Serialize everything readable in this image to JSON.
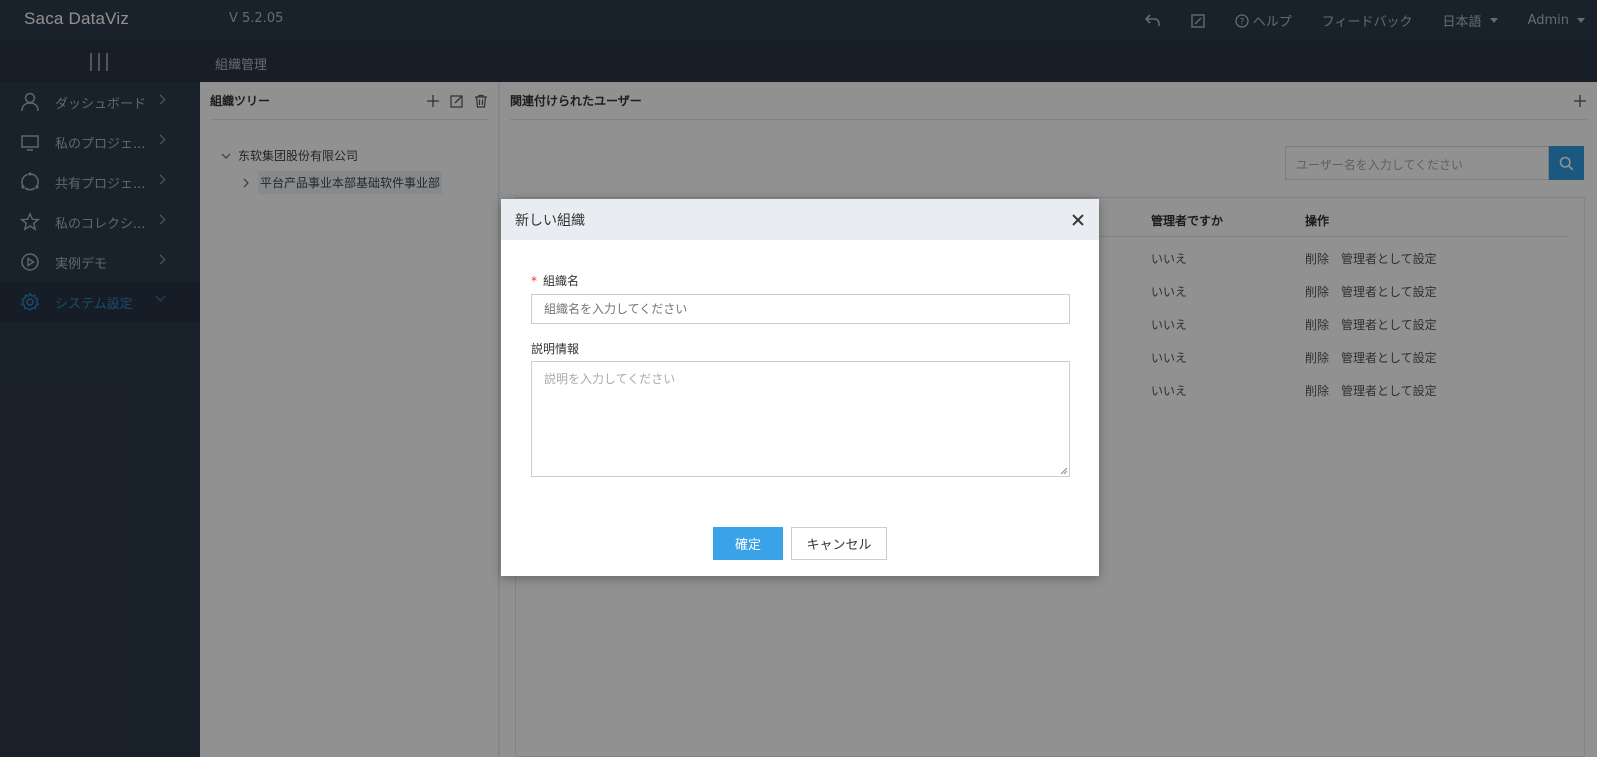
{
  "app": {
    "logo": "Saca DataViz",
    "version": "V 5.2.05"
  },
  "topbar": {
    "help": "ヘルプ",
    "feedback": "フィードバック",
    "language": "日本語",
    "user": "Admin"
  },
  "subbar": {
    "page_title": "組織管理"
  },
  "sidebar": {
    "items": [
      {
        "label": "ダッシュボード",
        "icon": "user-icon"
      },
      {
        "label": "私のプロジェ...",
        "icon": "monitor-icon"
      },
      {
        "label": "共有プロジェ...",
        "icon": "share-icon"
      },
      {
        "label": "私のコレクシ...",
        "icon": "star-icon"
      },
      {
        "label": "実例デモ",
        "icon": "play-icon"
      },
      {
        "label": "システム設定",
        "icon": "gear-icon"
      }
    ],
    "active_color": "#2e86c1"
  },
  "tree_panel": {
    "title": "組織ツリー",
    "nodes": [
      {
        "label": "东软集团股份有限公司"
      },
      {
        "label": "平台产品事业本部基础软件事业部"
      }
    ]
  },
  "user_panel": {
    "title": "関連付けられたユーザー",
    "search_placeholder": "ユーザー名を入力してください",
    "columns": {
      "admin": "管理者ですか",
      "ops": "操作"
    },
    "rows": [
      {
        "admin": "いいえ",
        "delete": "削除",
        "set_admin": "管理者として設定"
      },
      {
        "admin": "いいえ",
        "delete": "削除",
        "set_admin": "管理者として設定"
      },
      {
        "admin": "いいえ",
        "delete": "削除",
        "set_admin": "管理者として設定"
      },
      {
        "admin": "いいえ",
        "delete": "削除",
        "set_admin": "管理者として設定"
      },
      {
        "admin": "いいえ",
        "delete": "削除",
        "set_admin": "管理者として設定"
      }
    ]
  },
  "modal": {
    "title": "新しい組織",
    "required_mark": "*",
    "name_label": "組織名",
    "name_placeholder": "組織名を入力してください",
    "name_value": "",
    "desc_label": "説明情報",
    "desc_placeholder": "説明を入力してください",
    "desc_value": "",
    "ok": "確定",
    "cancel": "キャンセル",
    "accent": "#3aa3e8"
  }
}
